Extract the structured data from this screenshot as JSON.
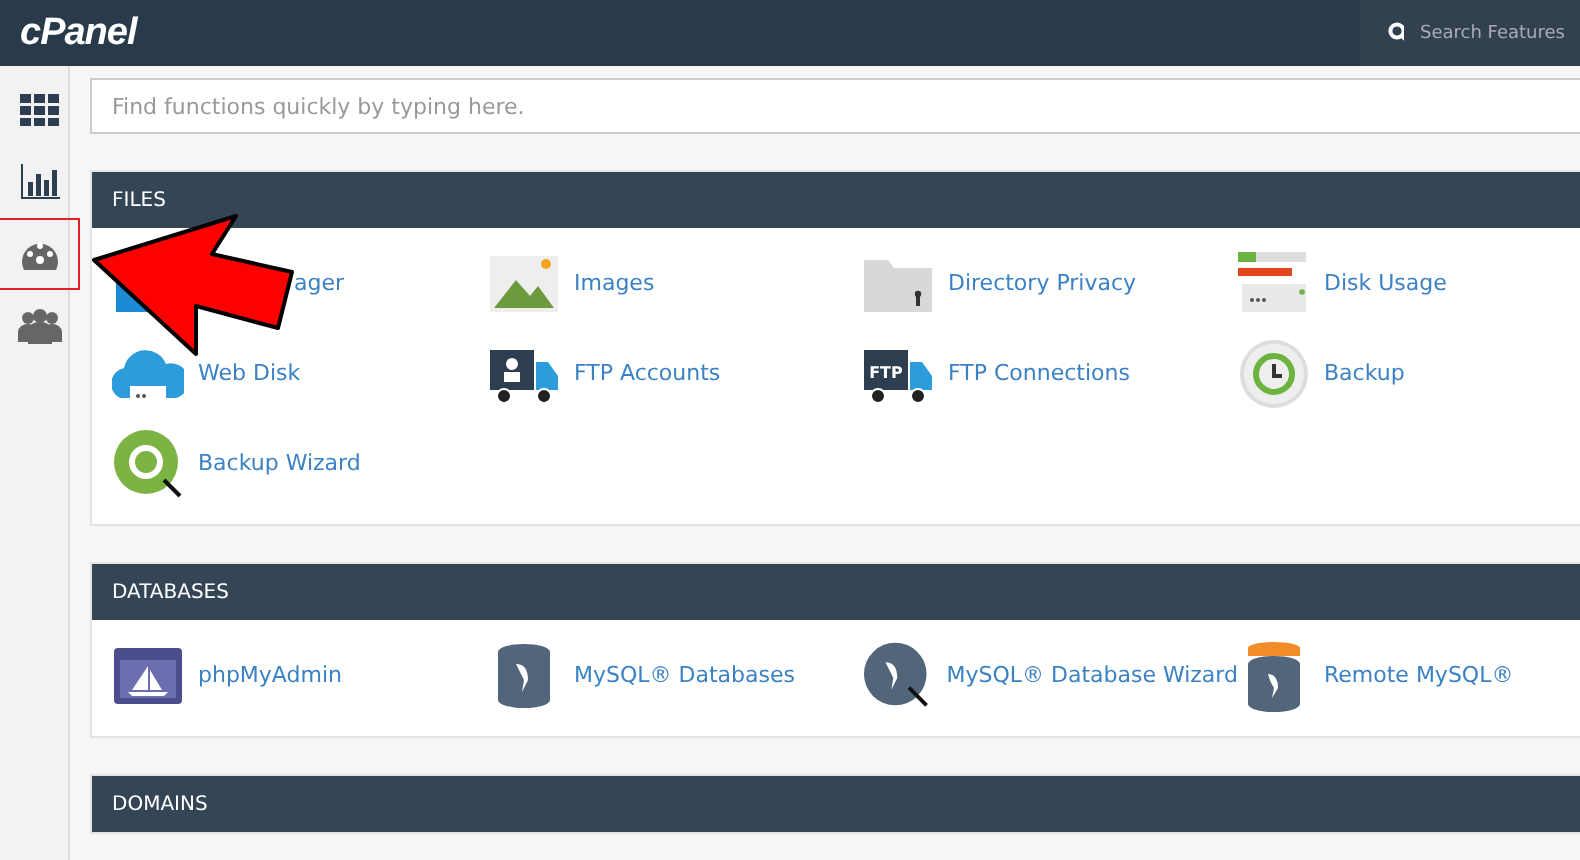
{
  "topbar": {
    "logo": "cPanel",
    "search": {
      "placeholder": "Search Features"
    }
  },
  "sidebar": {
    "items": [
      {
        "kind": "grid",
        "highlighted": false
      },
      {
        "kind": "chart",
        "highlighted": false
      },
      {
        "kind": "gauge",
        "highlighted": true
      },
      {
        "kind": "users",
        "highlighted": false
      }
    ]
  },
  "quick_search": {
    "placeholder": "Find functions quickly by typing here."
  },
  "sections": [
    {
      "title": "FILES",
      "items": [
        {
          "kind": "folder",
          "label": "ager",
          "covered": true
        },
        {
          "kind": "image",
          "label": "Images"
        },
        {
          "kind": "lock-folder",
          "label": "Directory Privacy"
        },
        {
          "kind": "disk",
          "label": "Disk Usage"
        },
        {
          "kind": "cloud",
          "label": "Web Disk"
        },
        {
          "kind": "user-truck",
          "label": "FTP Accounts"
        },
        {
          "kind": "ftp-truck",
          "label": "FTP Connections",
          "icon_text": "FTP"
        },
        {
          "kind": "backup",
          "label": "Backup"
        },
        {
          "kind": "wizard",
          "label": "Backup Wizard"
        }
      ]
    },
    {
      "title": "DATABASES",
      "items": [
        {
          "kind": "admin",
          "label": "phpMyAdmin"
        },
        {
          "kind": "db",
          "label": "MySQL® Databases"
        },
        {
          "kind": "db-wizard",
          "label": "MySQL® Database Wizard"
        },
        {
          "kind": "remote-db",
          "label": "Remote MySQL®"
        }
      ]
    },
    {
      "title": "DOMAINS"
    }
  ]
}
